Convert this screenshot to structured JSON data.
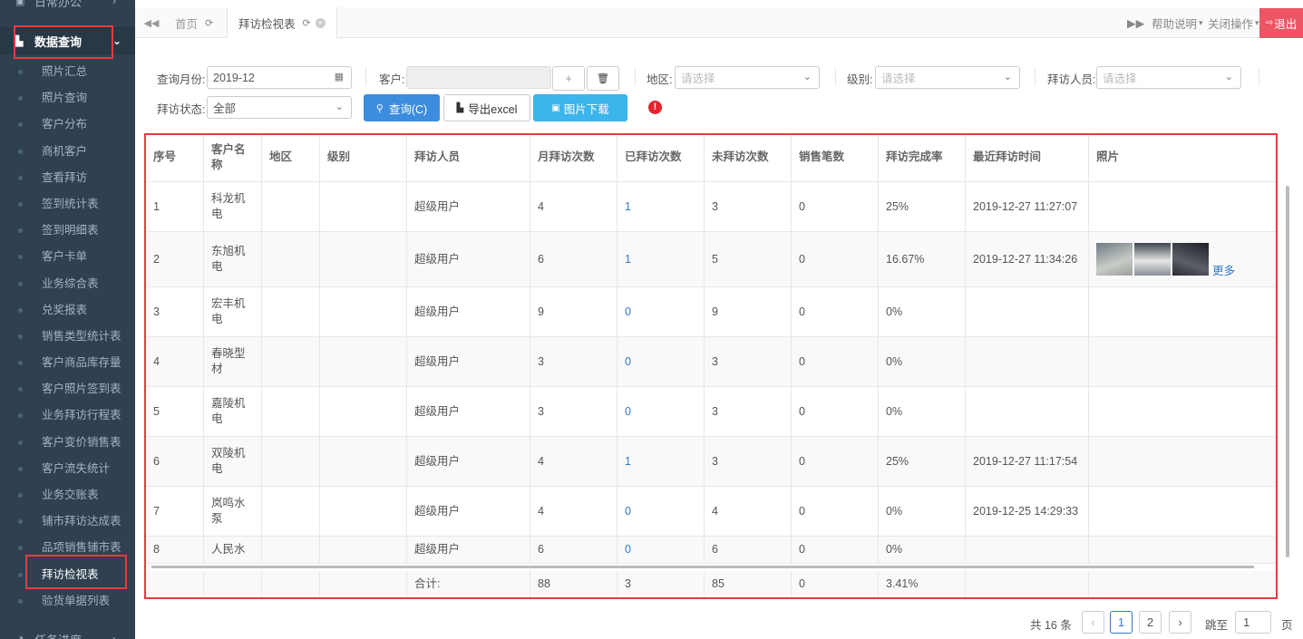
{
  "sidebar": {
    "prev_category": "日常办公",
    "active_category": "数据查询",
    "next_category": "任务进度",
    "items": [
      "照片汇总",
      "照片查询",
      "客户分布",
      "商机客户",
      "查看拜访",
      "签到统计表",
      "签到明细表",
      "客户卡单",
      "业务综合表",
      "兑奖报表",
      "销售类型统计表",
      "客户商品库存量",
      "客户照片签到表",
      "业务拜访行程表",
      "客户变价销售表",
      "客户流失统计",
      "业务交账表",
      "铺市拜访达成表",
      "品项销售铺市表",
      "拜访检视表",
      "验货单据列表"
    ],
    "selected_item": "拜访检视表"
  },
  "tabs": {
    "home": "首页",
    "current": "拜访检视表"
  },
  "header": {
    "help": "帮助说明",
    "close_ops": "关闭操作",
    "logout": "退出"
  },
  "filters": {
    "month_label": "查询月份:",
    "month_value": "2019-12",
    "customer_label": "客户:",
    "add_btn": "+",
    "region_label": "地区:",
    "region_placeholder": "请选择",
    "level_label": "级别:",
    "level_placeholder": "请选择",
    "visitor_label": "拜访人员:",
    "visitor_placeholder": "请选择",
    "status_label": "拜访状态:",
    "status_value": "全部",
    "query_btn": "查询(C)",
    "export_btn": "导出excel",
    "download_btn": "图片下载"
  },
  "table": {
    "headers": [
      "序号",
      "客户名称",
      "地区",
      "级别",
      "拜访人员",
      "月拜访次数",
      "已拜访次数",
      "未拜访次数",
      "销售笔数",
      "拜访完成率",
      "最近拜访时间",
      "照片"
    ],
    "rows": [
      {
        "no": "1",
        "name_l1": "科龙机",
        "name_l2": "电",
        "region": "",
        "level": "",
        "visitor": "超级用户",
        "monthly": "4",
        "done": "1",
        "pending": "3",
        "sales": "0",
        "rate": "25%",
        "last": "2019-12-27 11:27:07"
      },
      {
        "no": "2",
        "name_l1": "东旭机",
        "name_l2": "电",
        "region": "",
        "level": "",
        "visitor": "超级用户",
        "monthly": "6",
        "done": "1",
        "pending": "5",
        "sales": "0",
        "rate": "16.67%",
        "last": "2019-12-27 11:34:26",
        "more": "更多"
      },
      {
        "no": "3",
        "name_l1": "宏丰机",
        "name_l2": "电",
        "region": "",
        "level": "",
        "visitor": "超级用户",
        "monthly": "9",
        "done": "0",
        "pending": "9",
        "sales": "0",
        "rate": "0%",
        "last": ""
      },
      {
        "no": "4",
        "name_l1": "春晓型",
        "name_l2": "材",
        "region": "",
        "level": "",
        "visitor": "超级用户",
        "monthly": "3",
        "done": "0",
        "pending": "3",
        "sales": "0",
        "rate": "0%",
        "last": ""
      },
      {
        "no": "5",
        "name_l1": "嘉陵机",
        "name_l2": "电",
        "region": "",
        "level": "",
        "visitor": "超级用户",
        "monthly": "3",
        "done": "0",
        "pending": "3",
        "sales": "0",
        "rate": "0%",
        "last": ""
      },
      {
        "no": "6",
        "name_l1": "双陵机",
        "name_l2": "电",
        "region": "",
        "level": "",
        "visitor": "超级用户",
        "monthly": "4",
        "done": "1",
        "pending": "3",
        "sales": "0",
        "rate": "25%",
        "last": "2019-12-27 11:17:54"
      },
      {
        "no": "7",
        "name_l1": "岚鸣水",
        "name_l2": "泵",
        "region": "",
        "level": "",
        "visitor": "超级用户",
        "monthly": "4",
        "done": "0",
        "pending": "4",
        "sales": "0",
        "rate": "0%",
        "last": "2019-12-25 14:29:33"
      },
      {
        "no": "8",
        "name_l1": "人民水",
        "name_l2": "",
        "region": "",
        "level": "",
        "visitor": "超级用户",
        "monthly": "6",
        "done": "0",
        "pending": "6",
        "sales": "0",
        "rate": "0%",
        "last": ""
      }
    ],
    "footer": {
      "label": "合计:",
      "monthly": "88",
      "done": "3",
      "pending": "85",
      "sales": "0",
      "rate": "3.41%"
    }
  },
  "pagination": {
    "total": "共 16 条",
    "pages": [
      "1",
      "2"
    ],
    "current": "1",
    "jump_label": "跳至",
    "jump_value": "1",
    "page_unit": "页"
  }
}
